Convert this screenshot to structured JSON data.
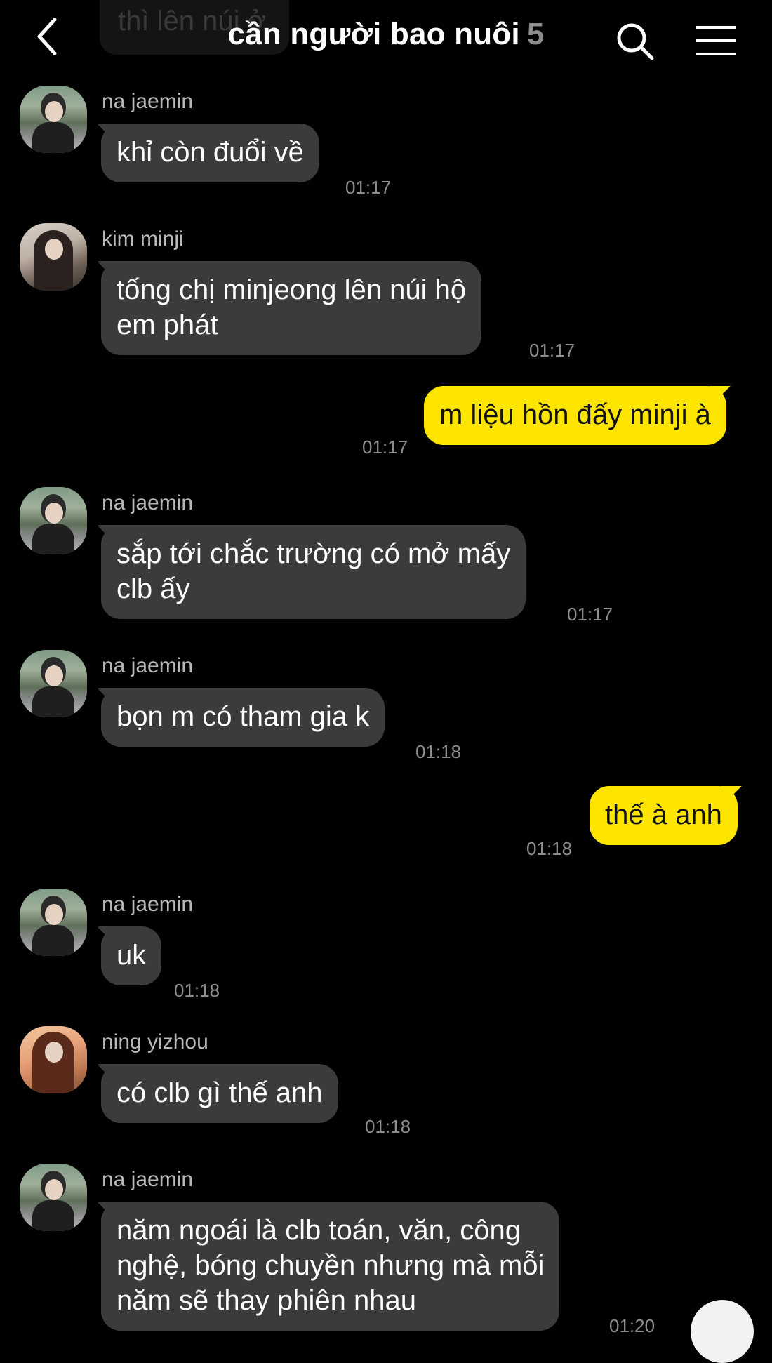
{
  "header": {
    "title": "cần người bao nuôi",
    "member_count": "5",
    "prev_message_fragment": "thì lên núi ở"
  },
  "messages": [
    {
      "sender": "na jaemin",
      "text": "khỉ còn đuổi về",
      "time": "01:17"
    },
    {
      "sender": "kim minji",
      "line1": "tống chị minjeong lên núi hộ",
      "line2": "em phát",
      "time": "01:17"
    },
    {
      "text": "m liệu hồn đấy minji à",
      "time": "01:17"
    },
    {
      "sender": "na jaemin",
      "line1": "sắp tới chắc trường có mở mấy",
      "line2": "clb ấy",
      "time": "01:17"
    },
    {
      "sender": "na jaemin",
      "text": "bọn m có tham gia k",
      "time": "01:18"
    },
    {
      "text": "thế à anh",
      "time": "01:18"
    },
    {
      "sender": "na jaemin",
      "text": "uk",
      "time": "01:18"
    },
    {
      "sender": "ning yizhou",
      "text": "có clb gì thế anh",
      "time": "01:18"
    },
    {
      "sender": "na jaemin",
      "line1": "năm ngoái là clb toán, văn, công",
      "line2": "nghệ, bóng chuyền nhưng mà mỗi",
      "line3": "năm sẽ thay phiên nhau",
      "time": "01:20"
    }
  ],
  "icons": {
    "back": "chevron-left-icon",
    "search": "search-icon",
    "menu": "hamburger-menu-icon"
  },
  "colors": {
    "background": "#000000",
    "incoming_bubble": "#3b3b3d",
    "outgoing_bubble": "#fde500"
  }
}
